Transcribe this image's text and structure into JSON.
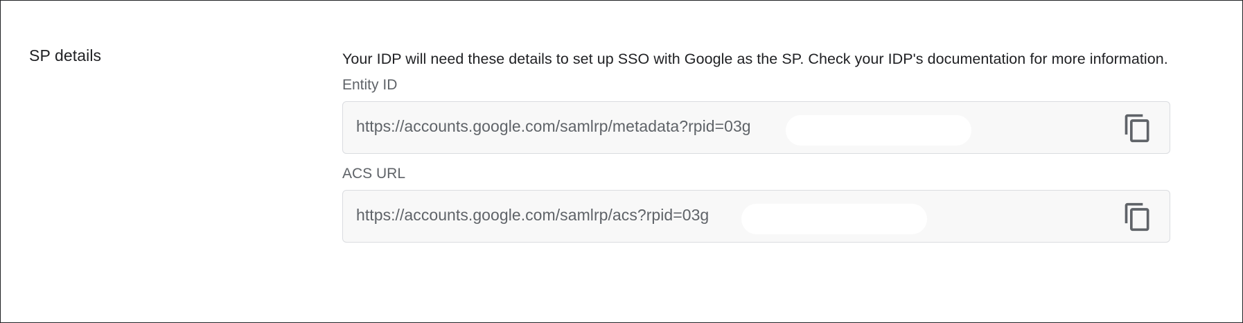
{
  "section": {
    "title": "SP details",
    "description": "Your IDP will need these details to set up SSO with Google as the SP. Check your IDP's documentation for more information."
  },
  "fields": [
    {
      "label": "Entity ID",
      "value": "https://accounts.google.com/samlrp/metadata?rpid=03g",
      "copy_icon": "copy-icon"
    },
    {
      "label": "ACS URL",
      "value": "https://accounts.google.com/samlrp/acs?rpid=03g",
      "copy_icon": "copy-icon"
    }
  ],
  "colors": {
    "text_primary": "#202124",
    "text_secondary": "#5f6368",
    "field_background": "#f8f8f8",
    "field_border": "#dadce0",
    "icon": "#5f6368"
  }
}
